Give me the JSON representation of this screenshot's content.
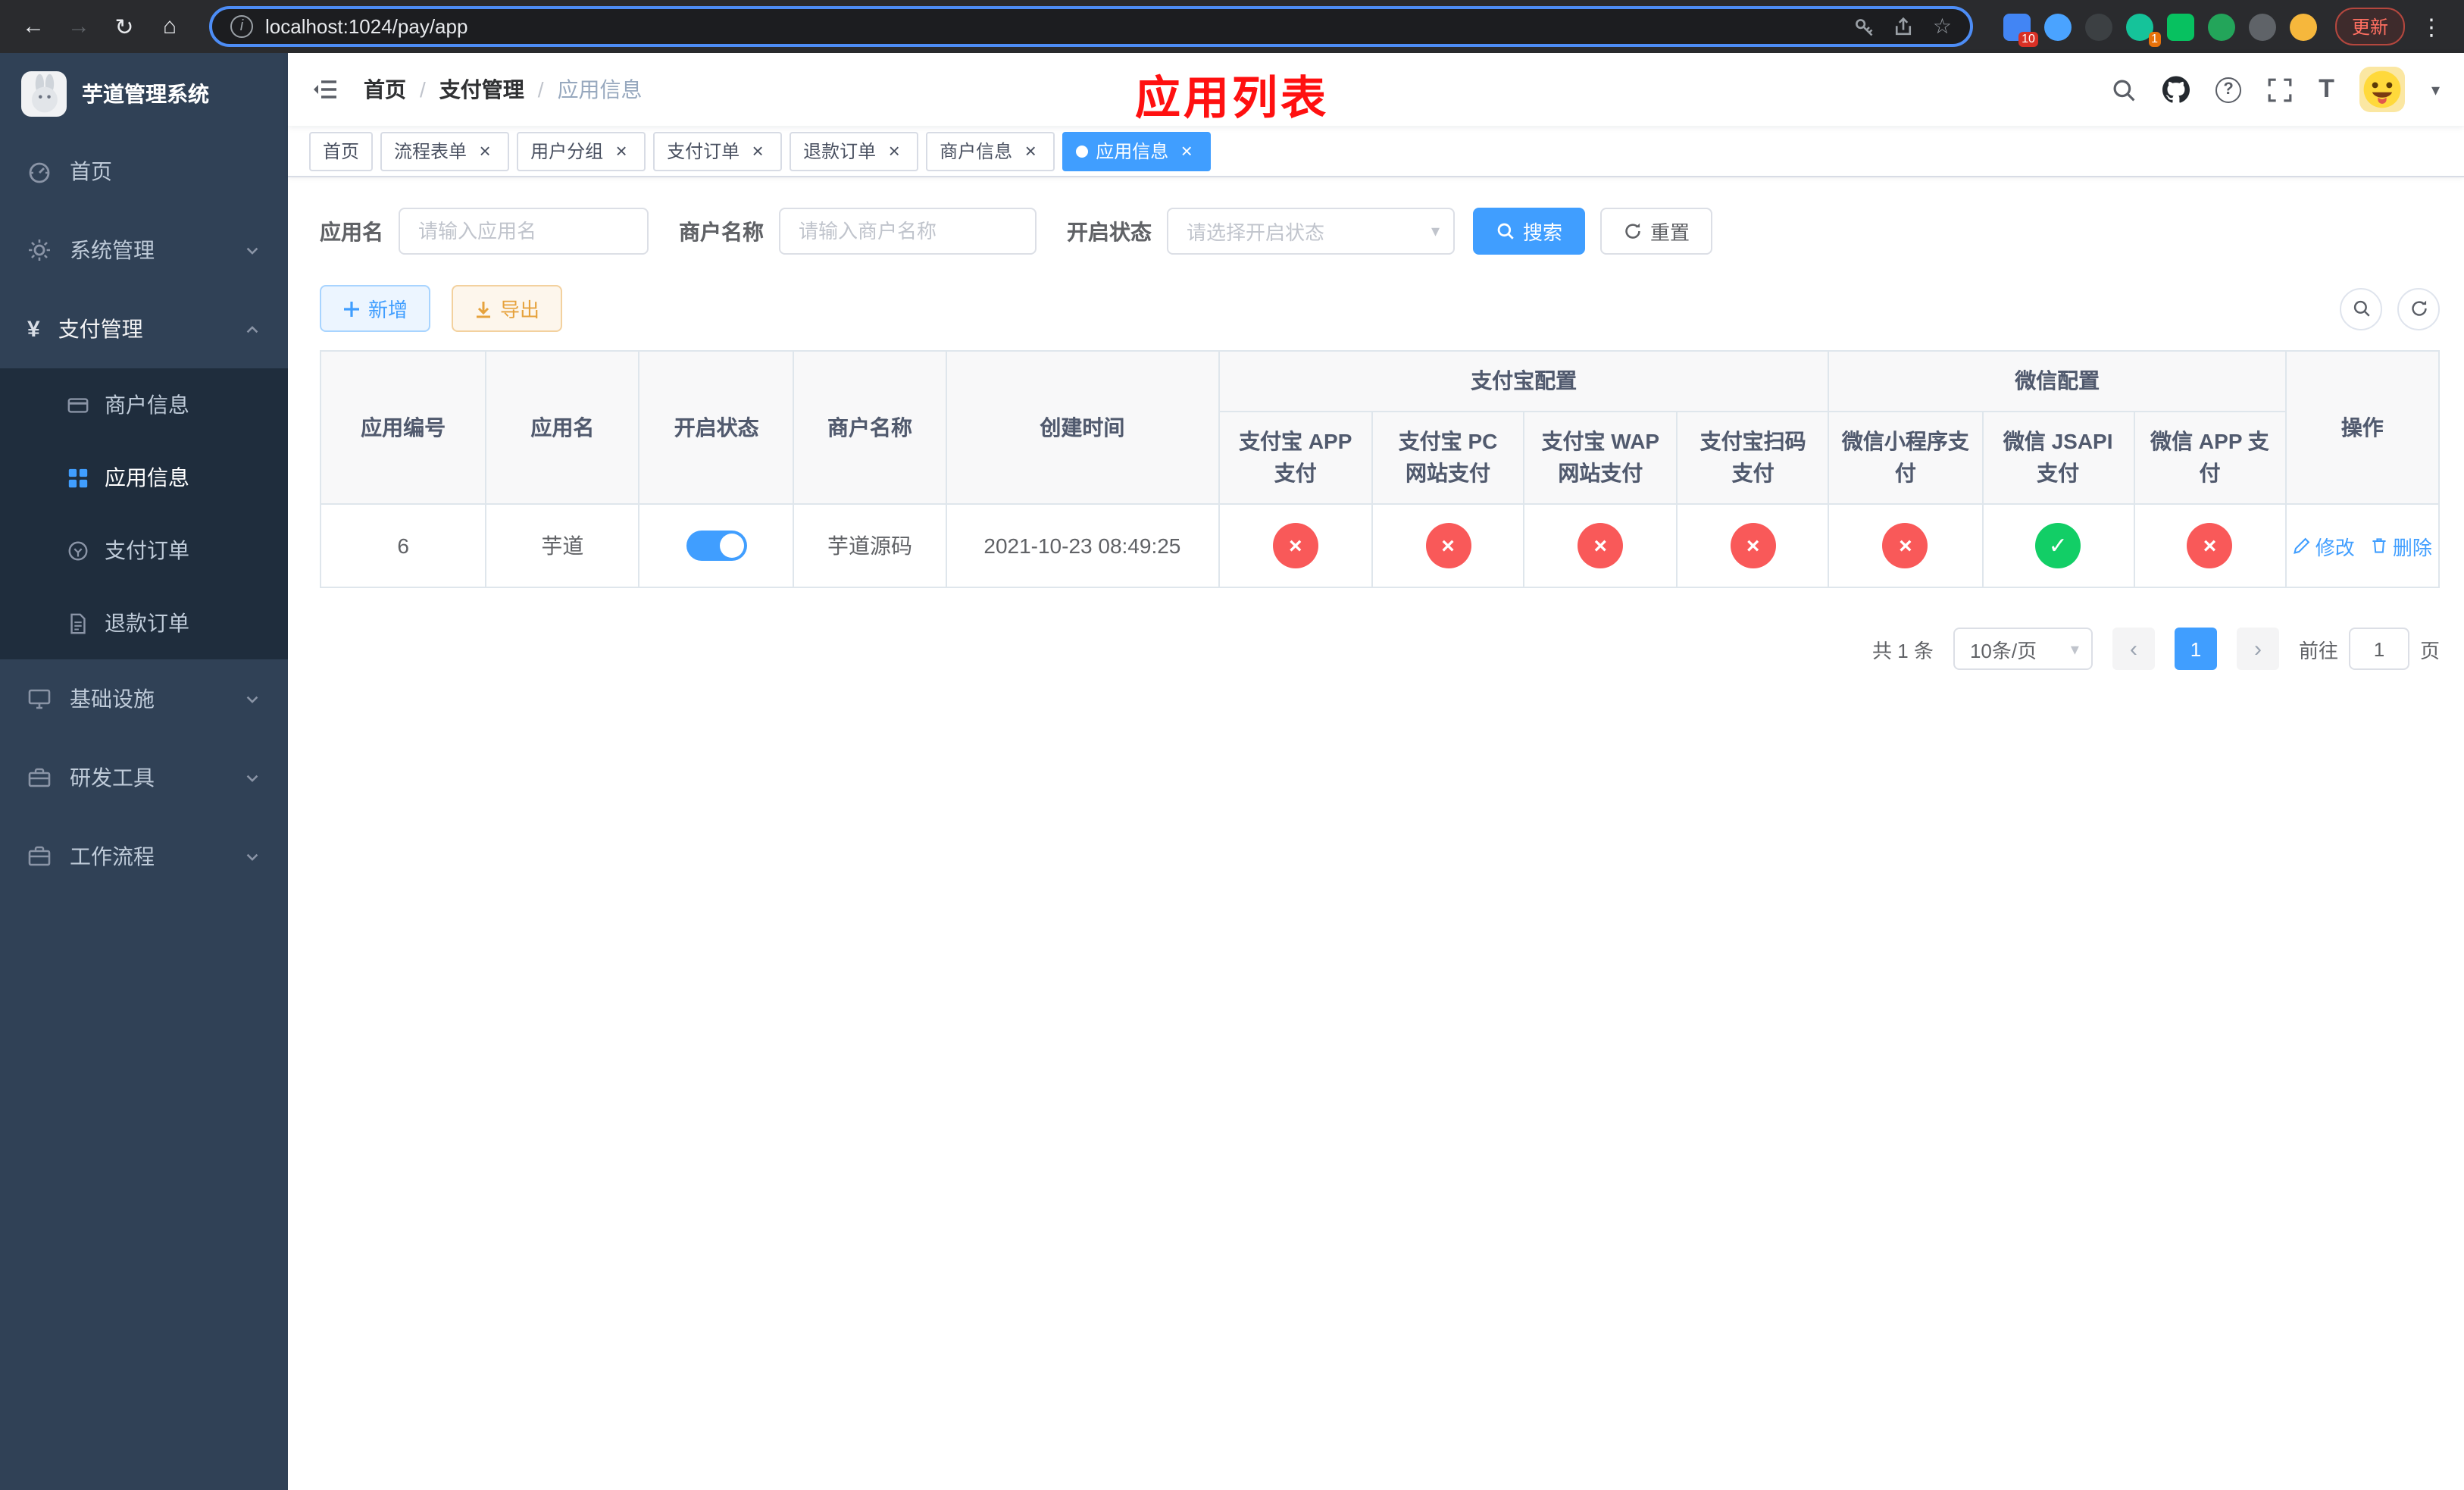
{
  "theme": {
    "primary": "#409eff",
    "success": "#12ce66",
    "danger": "#f95959",
    "warning": "#e6a23c",
    "sidebar_bg": "#304156",
    "submenu_bg": "#1f2d3d",
    "annotation_red": "#ff1010"
  },
  "icons": {
    "back": "←",
    "forward": "→",
    "reload": "↻",
    "home": "⌂",
    "info": "i",
    "star": "☆",
    "kebab": "⋮",
    "question": "?",
    "font_size": "T",
    "caret": "▾",
    "close": "×",
    "check": "✓",
    "cross": "×",
    "prev": "‹",
    "next": "›",
    "sep": "/"
  },
  "browser": {
    "url": "localhost:1024/pay/app",
    "update_label": "更新",
    "extension_badge_1": "10",
    "extension_badge_2": "1"
  },
  "sidebar": {
    "app_title": "芋道管理系统",
    "items": [
      {
        "label": "首页"
      },
      {
        "label": "系统管理"
      },
      {
        "label": "支付管理"
      },
      {
        "label": "基础设施"
      },
      {
        "label": "研发工具"
      },
      {
        "label": "工作流程"
      }
    ],
    "payment_children": [
      {
        "label": "商户信息"
      },
      {
        "label": "应用信息"
      },
      {
        "label": "支付订单"
      },
      {
        "label": "退款订单"
      }
    ]
  },
  "header": {
    "breadcrumb": [
      "首页",
      "支付管理",
      "应用信息"
    ],
    "annotation": "应用列表"
  },
  "tabs": [
    {
      "label": "首页",
      "closable": false,
      "active": false
    },
    {
      "label": "流程表单",
      "closable": true,
      "active": false
    },
    {
      "label": "用户分组",
      "closable": true,
      "active": false
    },
    {
      "label": "支付订单",
      "closable": true,
      "active": false
    },
    {
      "label": "退款订单",
      "closable": true,
      "active": false
    },
    {
      "label": "商户信息",
      "closable": true,
      "active": false
    },
    {
      "label": "应用信息",
      "closable": true,
      "active": true
    }
  ],
  "filters": {
    "app_name_label": "应用名",
    "app_name_placeholder": "请输入应用名",
    "merchant_label": "商户名称",
    "merchant_placeholder": "请输入商户名称",
    "status_label": "开启状态",
    "status_placeholder": "请选择开启状态",
    "search_label": "搜索",
    "reset_label": "重置"
  },
  "toolbar": {
    "add_label": "新增",
    "export_label": "导出"
  },
  "table": {
    "plain_columns": [
      "应用编号",
      "应用名",
      "开启状态",
      "商户名称",
      "创建时间"
    ],
    "groups": [
      {
        "label": "支付宝配置",
        "columns": [
          "支付宝 APP 支付",
          "支付宝 PC 网站支付",
          "支付宝 WAP 网站支付",
          "支付宝扫码支付"
        ]
      },
      {
        "label": "微信配置",
        "columns": [
          "微信小程序支付",
          "微信 JSAPI 支付",
          "微信 APP 支付"
        ]
      }
    ],
    "action_column": "操作",
    "row": {
      "id": "6",
      "name": "芋道",
      "enabled": true,
      "merchant": "芋道源码",
      "created": "2021-10-23 08:49:25",
      "statuses": [
        false,
        false,
        false,
        false,
        false,
        true,
        false
      ],
      "actions": [
        {
          "label": "修改"
        },
        {
          "label": "删除"
        }
      ]
    }
  },
  "pagination": {
    "total": "共 1 条",
    "page_size": "10条/页",
    "active_page": "1",
    "goto_label": "前往",
    "goto_value": "1",
    "goto_unit": "页"
  }
}
